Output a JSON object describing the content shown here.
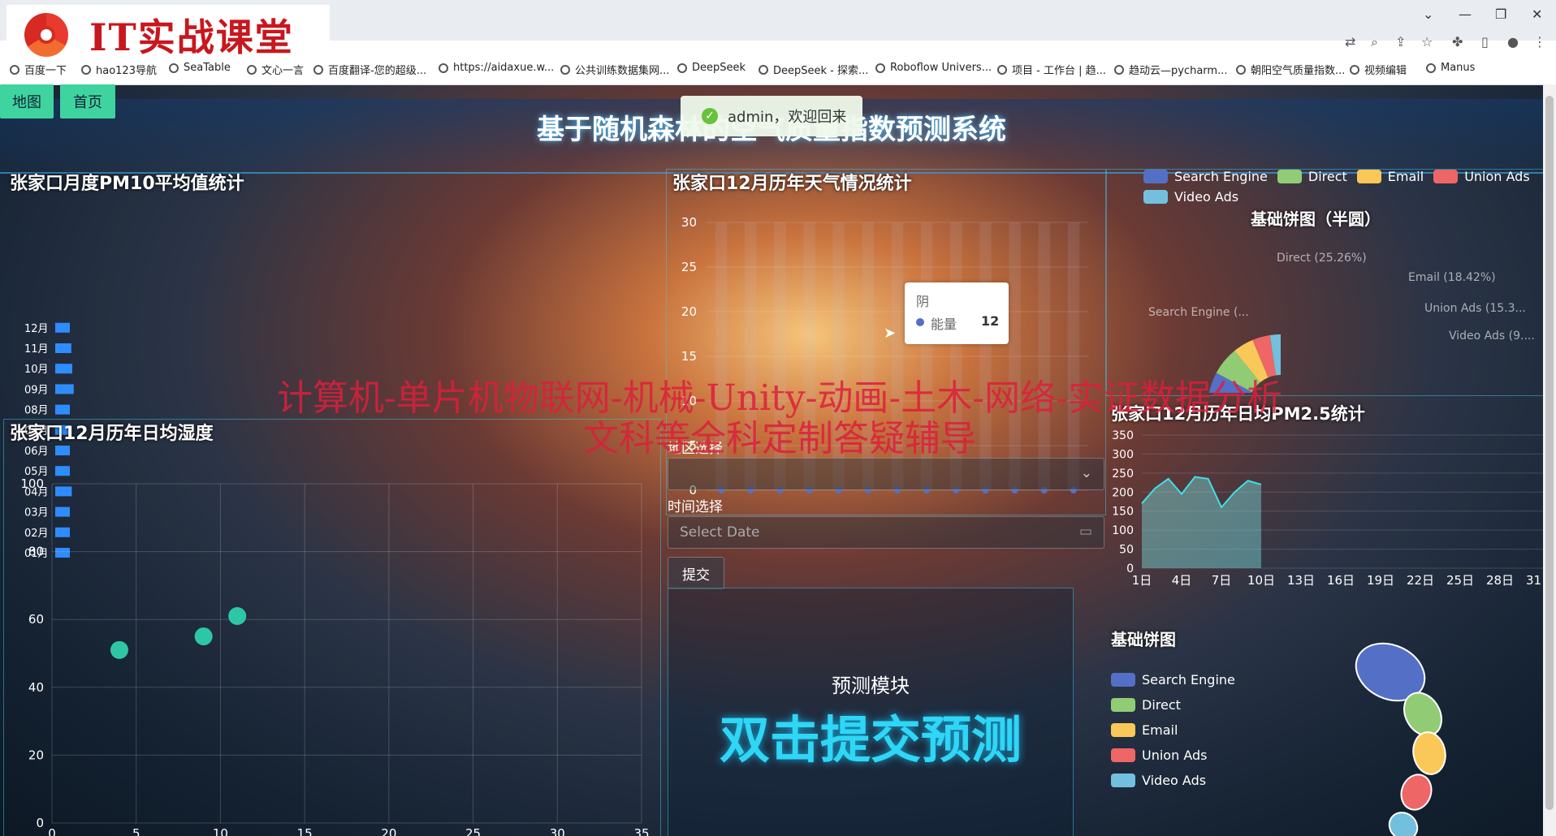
{
  "browser": {
    "bookmarks": [
      "百度一下",
      "hao123导航",
      "SeaTable",
      "文心一言",
      "百度翻译-您的超级...",
      "https://aidaxue.w...",
      "公共训练数据集网...",
      "DeepSeek",
      "DeepSeek - 探索...",
      "Roboflow Univers...",
      "项目 - 工作台 | 趋...",
      "趋动云—pycharm...",
      "朝阳空气质量指数...",
      "视频编辑",
      "Manus"
    ],
    "logo_text": "IT实战课堂"
  },
  "nav": {
    "map": "地图",
    "home": "首页"
  },
  "title": "基于随机森林的空气质量指数预测系统",
  "toast": "admin，欢迎回来",
  "watermark": [
    "计算机-单片机物联网-机械-Unity-动画-土木-网络-实证数据分析",
    "文科等全科定制答疑辅导"
  ],
  "colors": {
    "blue": "#5470c6",
    "green": "#91cc75",
    "yellow": "#fac858",
    "red": "#ee6666",
    "cyan": "#73c0de",
    "teal": "#2ec7a6"
  },
  "form": {
    "region_label": "地区选择",
    "region_value": "",
    "date_label": "时间选择",
    "date_placeholder": "Select Date",
    "submit": "提交"
  },
  "predict": {
    "label": "预测模块",
    "big": "双击提交预测"
  },
  "chart_data": [
    {
      "type": "bar",
      "title": "张家口月度PM10平均值统计",
      "orientation": "horizontal",
      "categories": [
        "01月",
        "02月",
        "03月",
        "04月",
        "05月",
        "06月",
        "07月",
        "08月",
        "09月",
        "10月",
        "11月",
        "12月"
      ],
      "values": [
        3.0,
        3.0,
        3.0,
        3.4,
        3.0,
        3.0,
        3.0,
        3.0,
        3.8,
        3.5,
        3.3,
        3.0
      ]
    },
    {
      "type": "bar",
      "title": "张家口12月历年天气情况统计",
      "ylim": [
        0,
        30
      ],
      "yticks": [
        0,
        5,
        10,
        15,
        20,
        25,
        30
      ],
      "tooltip": {
        "category": "阴",
        "series": "能量",
        "value": "12"
      },
      "values": [
        0,
        0,
        0,
        0,
        0,
        0,
        0,
        0,
        0,
        0,
        0,
        0,
        0
      ]
    },
    {
      "type": "pie",
      "title": "基础饼图（半圆）",
      "legend": [
        "Search Engine",
        "Direct",
        "Email",
        "Union Ads",
        "Video Ads"
      ],
      "labels": [
        "Search Engine (...",
        "Direct (25.26%)",
        "Email (18.42%)",
        "Union Ads (15.3...",
        "Video Ads (9...."
      ],
      "values": [
        31.58,
        25.26,
        18.42,
        15.79,
        9.47
      ]
    },
    {
      "type": "scatter",
      "title": "张家口12月历年日均湿度",
      "xlim": [
        0,
        35
      ],
      "ylim": [
        0,
        100
      ],
      "xticks": [
        "0",
        "5",
        "10",
        "15",
        "20",
        "25",
        "30",
        "35"
      ],
      "yticks": [
        "0",
        "20",
        "40",
        "60",
        "80",
        "100"
      ],
      "points": [
        [
          4,
          51
        ],
        [
          9,
          55
        ],
        [
          11,
          61
        ]
      ]
    },
    {
      "type": "area",
      "title": "张家口12月历年日均PM2.5统计",
      "ylim": [
        0,
        350
      ],
      "yticks": [
        0,
        50,
        100,
        150,
        200,
        250,
        300,
        350
      ],
      "xticks": [
        "1日",
        "4日",
        "7日",
        "10日",
        "13日",
        "16日",
        "19日",
        "22日",
        "25日",
        "28日",
        "31日"
      ],
      "x": [
        1,
        2,
        3,
        4,
        5,
        6,
        7,
        8,
        9,
        10
      ],
      "values": [
        170,
        210,
        235,
        195,
        240,
        235,
        160,
        200,
        230,
        220
      ]
    },
    {
      "type": "pie",
      "title": "基础饼图",
      "legend": [
        "Search Engine",
        "Direct",
        "Email",
        "Union Ads",
        "Video Ads"
      ],
      "values": [
        1048,
        735,
        580,
        484,
        300
      ]
    }
  ]
}
